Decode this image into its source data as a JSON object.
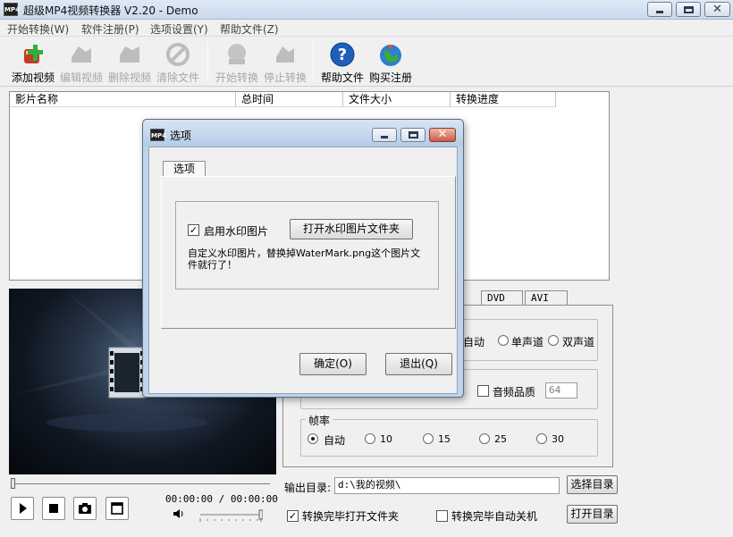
{
  "window": {
    "title": "超级MP4视频转换器 V2.20 - Demo",
    "icon_label": "MP4"
  },
  "menu": [
    {
      "label": "开始转换(W)"
    },
    {
      "label": "软件注册(P)"
    },
    {
      "label": "选项设置(Y)"
    },
    {
      "label": "帮助文件(Z)"
    }
  ],
  "toolbar": {
    "add_video": "添加视频",
    "edit_video": "编辑视频",
    "delete_video": "删除视频",
    "clear_files": "清除文件",
    "start_convert": "开始转换",
    "stop_convert": "停止转换",
    "help_file": "帮助文件",
    "buy_register": "购买注册"
  },
  "file_list": {
    "columns": [
      "影片名称",
      "总时间",
      "文件大小",
      "转换进度"
    ]
  },
  "player": {
    "time_text": "00:00:00 / 00:00:00",
    "play_icon": "play-icon",
    "stop_icon": "stop-icon",
    "snapshot_icon": "camera-icon",
    "fullscreen_icon": "window-icon"
  },
  "settings": {
    "tabs": [
      "DVD",
      "AVI"
    ],
    "channel": {
      "options": [
        "自动",
        "单声道",
        "双声道"
      ],
      "selected": "自动"
    },
    "audio_quality": {
      "label": "音频品质",
      "value": "64",
      "checked": false
    },
    "framerate": {
      "label": "帧率",
      "options": [
        "自动",
        "10",
        "15",
        "25",
        "30"
      ],
      "selected": "自动"
    },
    "output": {
      "label": "输出目录:",
      "path": "d:\\我的视频\\",
      "browse_button": "选择目录",
      "open_button": "打开目录",
      "open_after": "转换完毕打开文件夹",
      "open_after_checked": true,
      "shutdown_after": "转换完毕自动关机",
      "shutdown_after_checked": false
    }
  },
  "dialog": {
    "title": "选项",
    "icon_label": "MP4",
    "tab_label": "选项",
    "watermark_enabled": true,
    "watermark_label": "启用水印图片",
    "open_folder_button": "打开水印图片文件夹",
    "hint_line1": "自定义水印图片，替换掉WaterMark.png这个图片文",
    "hint_line2": "件就行了！",
    "ok_button": "确定(O)",
    "exit_button": "退出(Q)"
  },
  "colors": {
    "titlebar": "#c9d9ec",
    "dialog_frame": "#bfd3ea",
    "close_button": "#c95a45",
    "help_icon": "#1f5fb8",
    "add_icon_plus": "#2bb43a",
    "add_icon_box": "#c23a2a"
  }
}
